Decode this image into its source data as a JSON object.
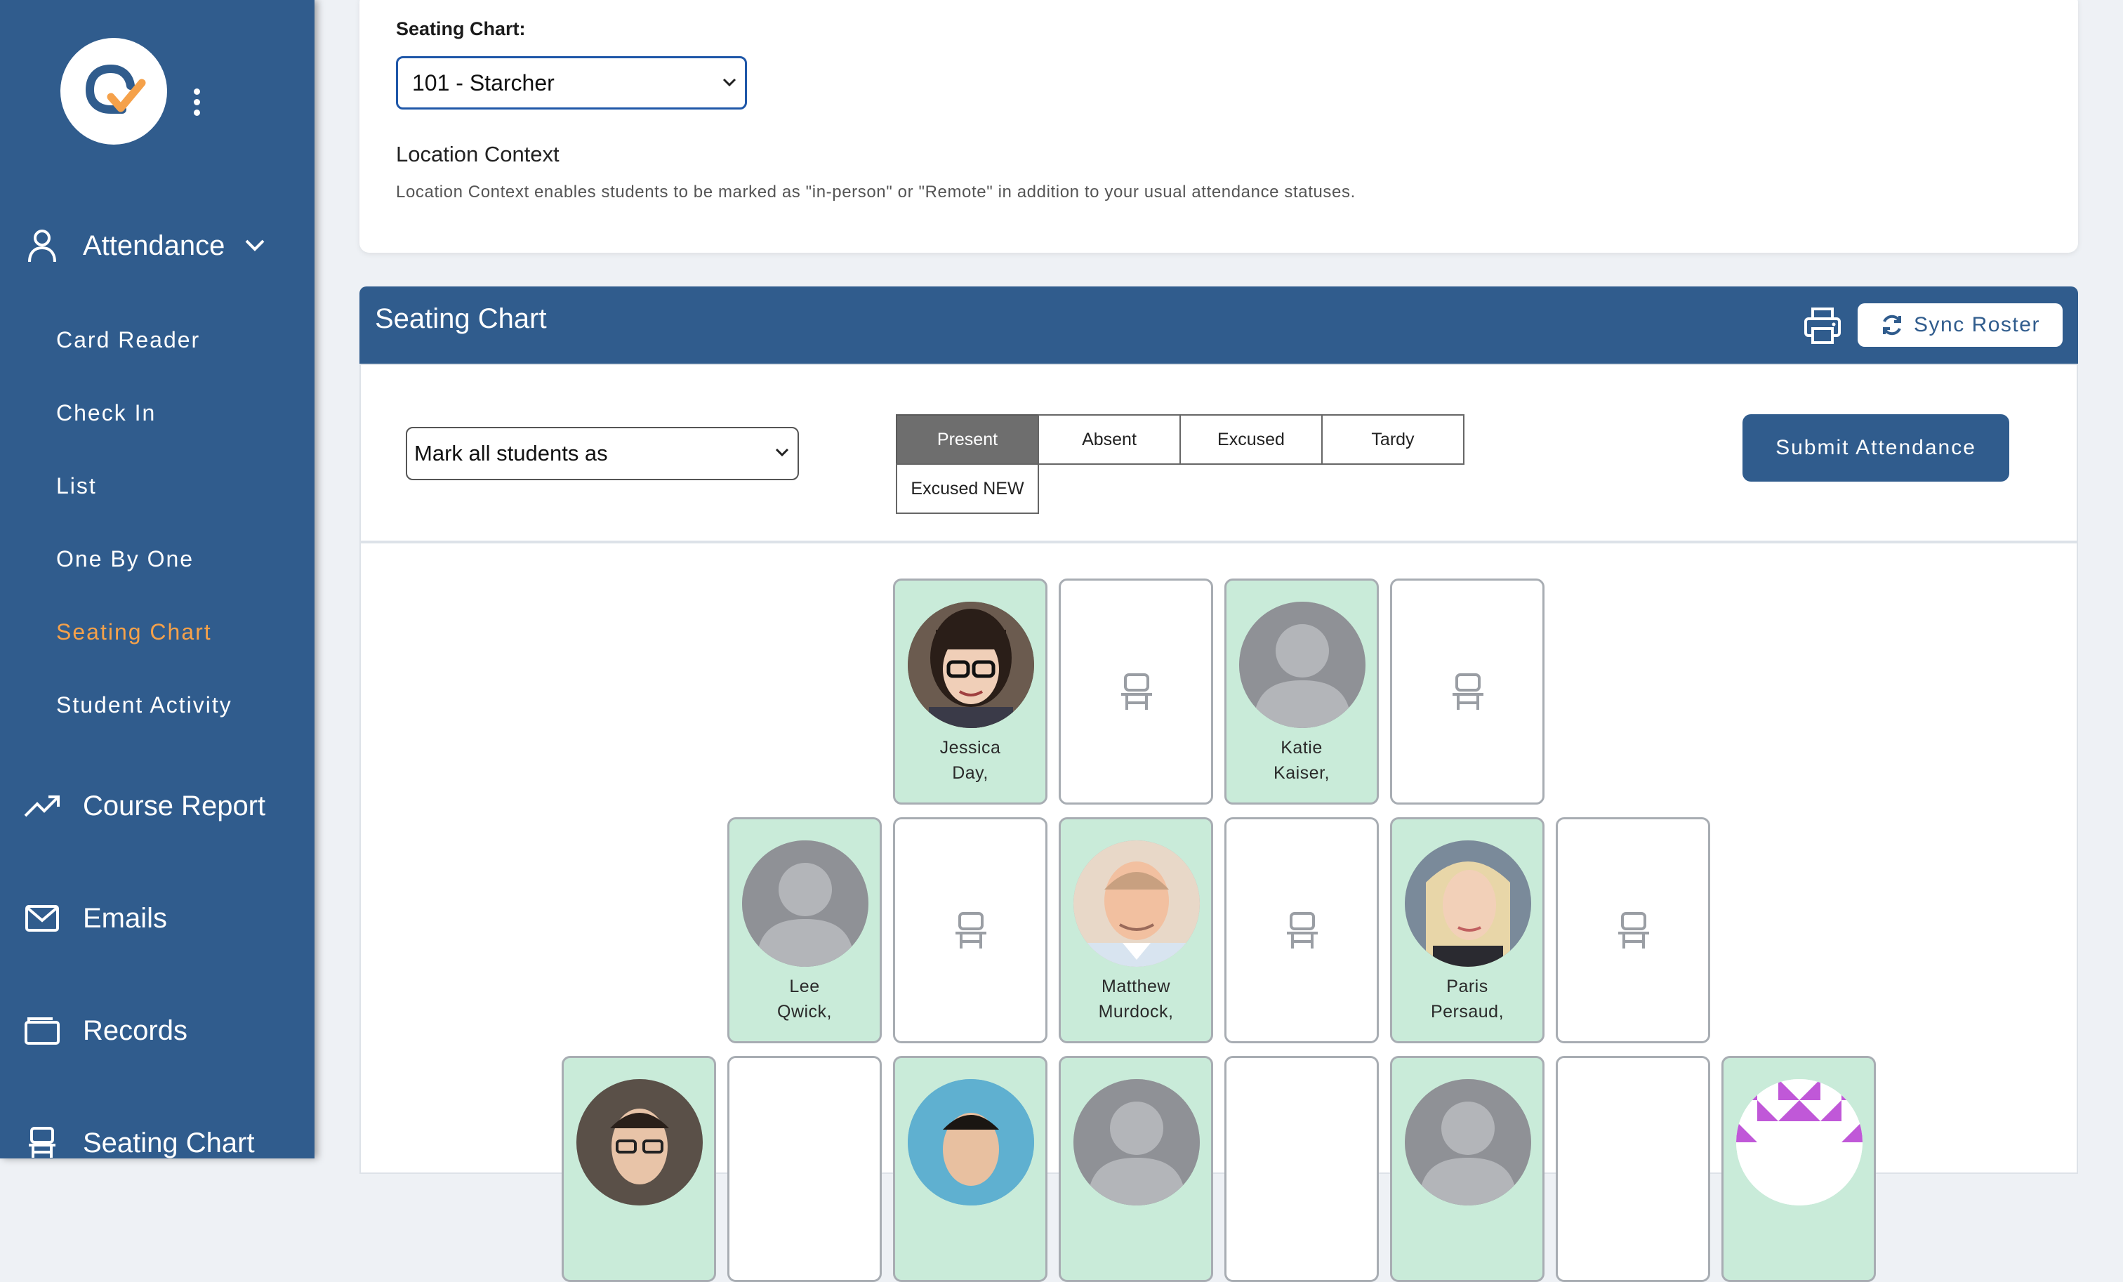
{
  "sidebar": {
    "sections": [
      {
        "label": "Attendance",
        "icon": "user-icon"
      },
      {
        "label": "Course Report",
        "icon": "trend-icon"
      },
      {
        "label": "Emails",
        "icon": "mail-icon"
      },
      {
        "label": "Records",
        "icon": "folder-icon"
      },
      {
        "label": "Seating Chart",
        "icon": "chair-icon"
      }
    ],
    "attendance_items": [
      "Card Reader",
      "Check In",
      "List",
      "One By One",
      "Seating Chart",
      "Student Activity"
    ],
    "active_item": "Seating Chart"
  },
  "settings": {
    "seating_label": "Seating Chart:",
    "seating_value": "101 - Starcher",
    "location_title": "Location Context",
    "location_desc": "Location Context enables students to be marked as \"in-person\" or \"Remote\" in addition to your usual attendance statuses."
  },
  "seating_chart": {
    "title": "Seating Chart",
    "sync_label": "Sync Roster",
    "mark_all_placeholder": "Mark all students as",
    "statuses": [
      "Present",
      "Absent",
      "Excused",
      "Tardy",
      "Excused NEW"
    ],
    "active_status": "Present",
    "submit_label": "Submit Attendance"
  },
  "seats": {
    "row1": [
      {
        "type": "student",
        "first": "Jessica",
        "last": "Day,",
        "photo": "photo"
      },
      {
        "type": "empty"
      },
      {
        "type": "student",
        "first": "Katie",
        "last": "Kaiser,",
        "photo": "placeholder"
      },
      {
        "type": "empty"
      }
    ],
    "row2": [
      {
        "type": "student",
        "first": "Lee",
        "last": "Qwick,",
        "photo": "placeholder"
      },
      {
        "type": "empty"
      },
      {
        "type": "student",
        "first": "Matthew",
        "last": "Murdock,",
        "photo": "photo"
      },
      {
        "type": "empty"
      },
      {
        "type": "student",
        "first": "Paris",
        "last": "Persaud,",
        "photo": "photo"
      },
      {
        "type": "empty"
      }
    ]
  },
  "colors": {
    "sidebar": "#305c8d",
    "accent": "#f5a14a",
    "seat_present": "#c9ebd9"
  }
}
